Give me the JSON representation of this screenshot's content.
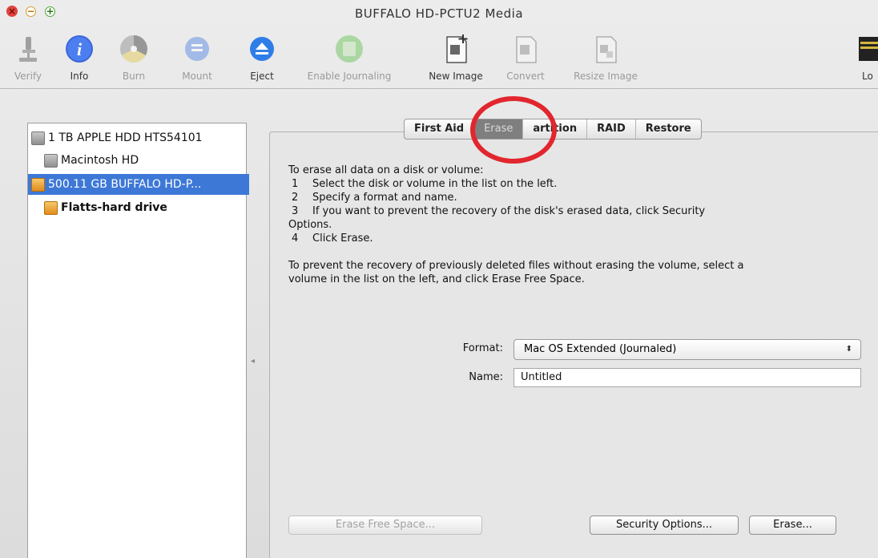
{
  "window": {
    "title": "BUFFALO HD-PCTU2 Media"
  },
  "toolbar": {
    "items": [
      {
        "label": "Verify",
        "icon": "microscope-icon",
        "enabled": false
      },
      {
        "label": "Info",
        "icon": "info-icon",
        "enabled": true
      },
      {
        "label": "Burn",
        "icon": "burn-icon",
        "enabled": false
      },
      {
        "label": "Mount",
        "icon": "mount-icon",
        "enabled": false
      },
      {
        "label": "Eject",
        "icon": "eject-icon",
        "enabled": true
      },
      {
        "label": "Enable Journaling",
        "icon": "journaling-icon",
        "enabled": false
      },
      {
        "label": "New Image",
        "icon": "new-image-icon",
        "enabled": true
      },
      {
        "label": "Convert",
        "icon": "convert-icon",
        "enabled": false
      },
      {
        "label": "Resize Image",
        "icon": "resize-image-icon",
        "enabled": false
      },
      {
        "label": "Lo",
        "icon": "log-icon",
        "enabled": true
      }
    ]
  },
  "sidebar": {
    "items": [
      {
        "label": "1 TB APPLE HDD HTS54101",
        "icon": "gray-disk-icon",
        "selected": false,
        "level": 0
      },
      {
        "label": "Macintosh HD",
        "icon": "gray-volume-icon",
        "selected": false,
        "level": 1
      },
      {
        "label": "500.11 GB BUFFALO HD-P...",
        "icon": "orange-disk-icon",
        "selected": true,
        "level": 0
      },
      {
        "label": "Flatts-hard drive",
        "icon": "orange-volume-icon",
        "selected": false,
        "level": 1
      }
    ]
  },
  "tabs": [
    {
      "label": "First Aid",
      "active": false
    },
    {
      "label": "Erase",
      "active": true
    },
    {
      "label": "Partition",
      "display": "artition",
      "active": false
    },
    {
      "label": "RAID",
      "active": false
    },
    {
      "label": "Restore",
      "active": false
    }
  ],
  "instructions": {
    "intro": "To erase all data on a disk or volume:",
    "steps": [
      {
        "num": "1",
        "text": "Select the disk or volume in the list on the left."
      },
      {
        "num": "2",
        "text": "Specify a format and name."
      },
      {
        "num": "3",
        "text": "If you want to prevent the recovery of the disk's erased data, click Security",
        "cont": "Options."
      },
      {
        "num": "4",
        "text": "Click Erase."
      }
    ],
    "para2_line1": "To prevent the recovery of previously deleted files without erasing the volume, select a",
    "para2_line2": "volume in the list on the left, and click Erase Free Space."
  },
  "form": {
    "format_label": "Format:",
    "format_value": "Mac OS Extended (Journaled)",
    "name_label": "Name:",
    "name_value": "Untitled"
  },
  "buttons": {
    "erase_free_space": "Erase Free Space...",
    "security_options": "Security Options...",
    "erase": "Erase..."
  },
  "colors": {
    "selection": "#3d78d7",
    "highlight_circle": "#e1262d"
  }
}
